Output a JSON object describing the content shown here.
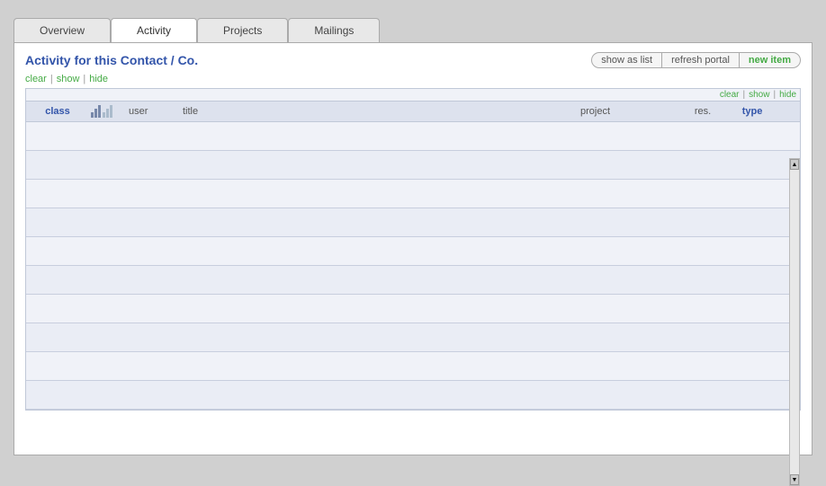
{
  "tabs": [
    {
      "id": "overview",
      "label": "Overview",
      "active": false
    },
    {
      "id": "activity",
      "label": "Activity",
      "active": true
    },
    {
      "id": "projects",
      "label": "Projects",
      "active": false
    },
    {
      "id": "mailings",
      "label": "Mailings",
      "active": false
    }
  ],
  "panel": {
    "title": "Activity for this Contact / Co.",
    "actions": {
      "show_as_list": "show as list",
      "refresh_portal": "refresh portal",
      "new_item": "new item"
    },
    "filter_left": {
      "clear": "clear",
      "show": "show",
      "hide": "hide"
    },
    "filter_right": {
      "clear": "clear",
      "show": "show",
      "hide": "hide"
    },
    "table": {
      "columns": [
        {
          "id": "class",
          "label": "class"
        },
        {
          "id": "icons",
          "label": ""
        },
        {
          "id": "user",
          "label": "user"
        },
        {
          "id": "title",
          "label": "title"
        },
        {
          "id": "project",
          "label": "project"
        },
        {
          "id": "res",
          "label": "res."
        },
        {
          "id": "type",
          "label": "type"
        }
      ],
      "rows": [
        {},
        {},
        {},
        {},
        {},
        {},
        {},
        {},
        {},
        {}
      ]
    }
  }
}
